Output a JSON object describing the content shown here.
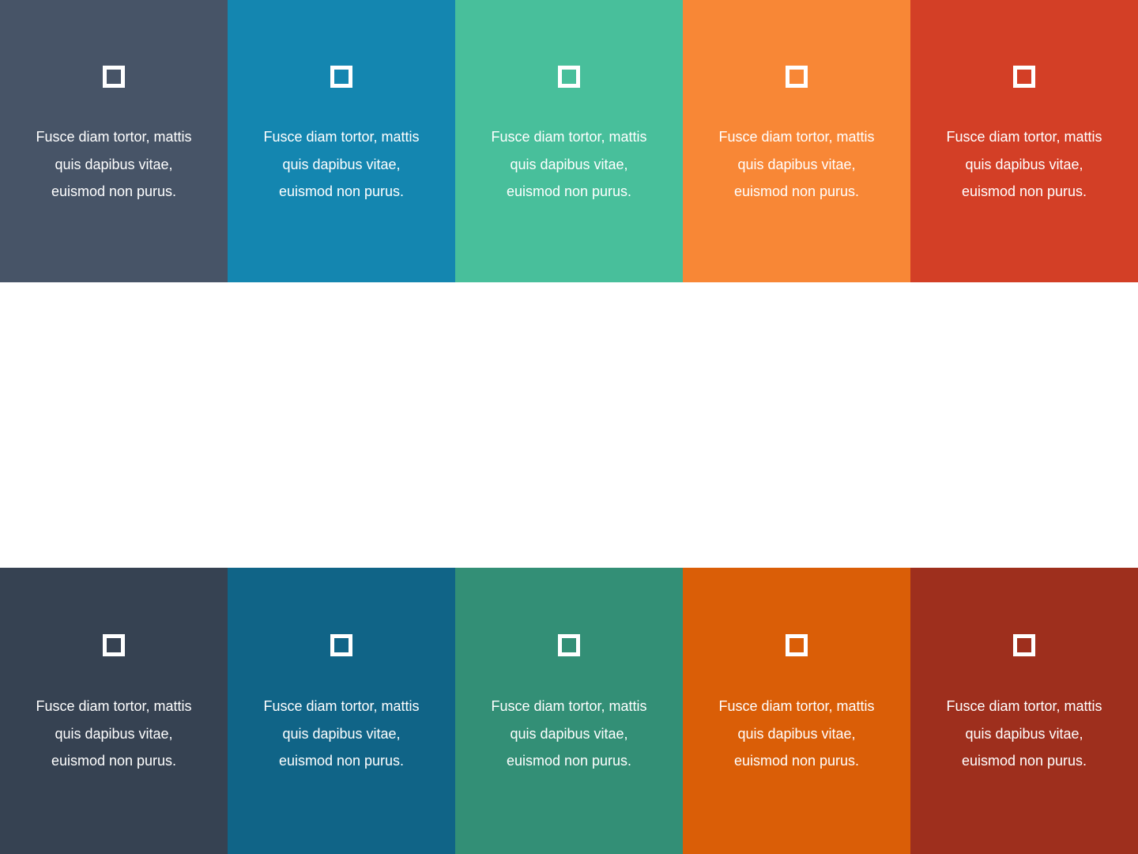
{
  "top_row": {
    "tiles": [
      {
        "icon": "square-outline-icon",
        "text": "Fusce diam tortor, mattis quis dapibus vitae, euismod non purus.",
        "color": "#475467"
      },
      {
        "icon": "square-outline-icon",
        "text": "Fusce diam tortor, mattis quis dapibus vitae, euismod non purus.",
        "color": "#1486B0"
      },
      {
        "icon": "square-outline-icon",
        "text": "Fusce diam tortor, mattis quis dapibus vitae, euismod non purus.",
        "color": "#48BF9B"
      },
      {
        "icon": "square-outline-icon",
        "text": "Fusce diam tortor, mattis quis dapibus vitae, euismod non purus.",
        "color": "#F88736"
      },
      {
        "icon": "square-outline-icon",
        "text": "Fusce diam tortor, mattis quis dapibus vitae, euismod non purus.",
        "color": "#D33F26"
      }
    ]
  },
  "bottom_row": {
    "tiles": [
      {
        "icon": "square-outline-icon",
        "text": "Fusce diam tortor, mattis quis dapibus vitae, euismod non purus.",
        "color": "#364252"
      },
      {
        "icon": "square-outline-icon",
        "text": "Fusce diam tortor, mattis quis dapibus vitae, euismod non purus.",
        "color": "#106487"
      },
      {
        "icon": "square-outline-icon",
        "text": "Fusce diam tortor, mattis quis dapibus vitae, euismod non purus.",
        "color": "#338F76"
      },
      {
        "icon": "square-outline-icon",
        "text": "Fusce diam tortor, mattis quis dapibus vitae, euismod non purus.",
        "color": "#DA5E07"
      },
      {
        "icon": "square-outline-icon",
        "text": "Fusce diam tortor, mattis quis dapibus vitae, euismod non purus.",
        "color": "#9E2F1D"
      }
    ]
  }
}
